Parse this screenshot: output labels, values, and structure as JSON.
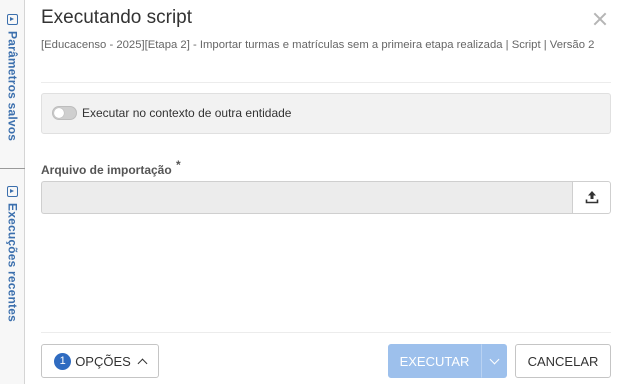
{
  "side_tabs": [
    {
      "label": "Parâmetros salvos",
      "icon": "panel-expand-icon"
    },
    {
      "label": "Execuções recentes",
      "icon": "panel-expand-icon"
    }
  ],
  "modal": {
    "title": "Executando script",
    "subtitle": "[Educacenso - 2025][Etapa 2] - Importar turmas e matrículas sem a primeira etapa realizada | Script | Versão 2",
    "context_toggle": {
      "label": "Executar no contexto de outra entidade",
      "checked": false
    },
    "file_field": {
      "label": "Arquivo de importação",
      "required_mark": "*",
      "value": ""
    },
    "footer": {
      "options_count": "1",
      "options_label": "OPÇÕES",
      "execute_label": "EXECUTAR",
      "cancel_label": "CANCELAR"
    }
  },
  "colors": {
    "accent": "#3b6fad",
    "badge": "#2f6bc0",
    "execute_disabled": "#9dc0ec"
  }
}
